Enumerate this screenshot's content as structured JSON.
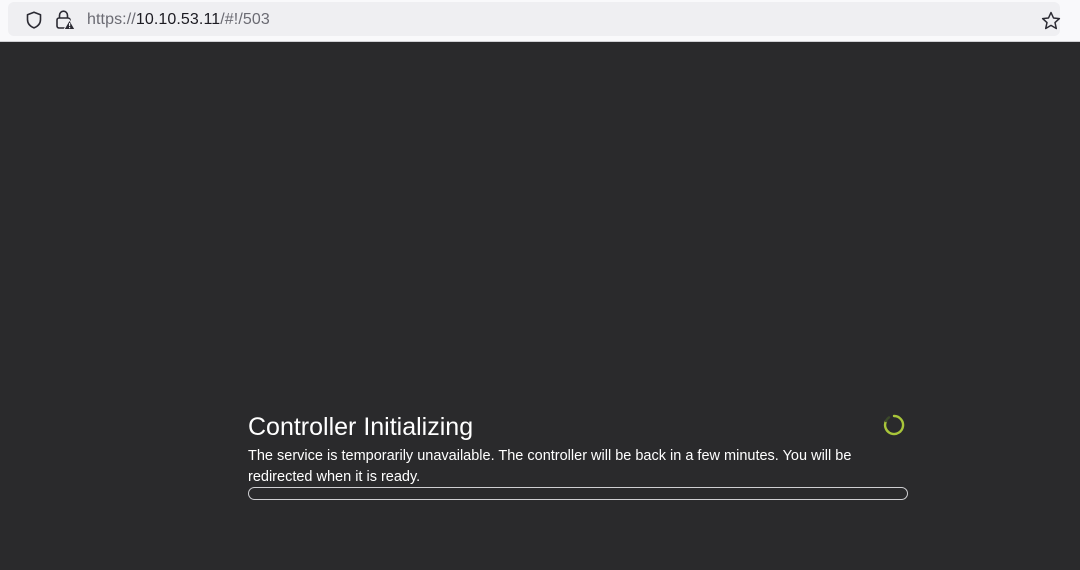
{
  "browser": {
    "url_scheme": "https://",
    "url_host": "10.10.53.11",
    "url_path": "/#!/503"
  },
  "icons": {
    "shield": "shield-icon",
    "lock": "lock-warning-icon",
    "star": "star-icon",
    "spinner": "loading-spinner-icon"
  },
  "status": {
    "title": "Controller Initializing",
    "message": "The service is temporarily unavailable. The controller will be back in a few minutes. You will be redirected when it is ready.",
    "progress_fraction": 0
  },
  "colors": {
    "background": "#2a2a2c",
    "spinner_accent": "#a8c53a",
    "text": "#ffffff"
  }
}
